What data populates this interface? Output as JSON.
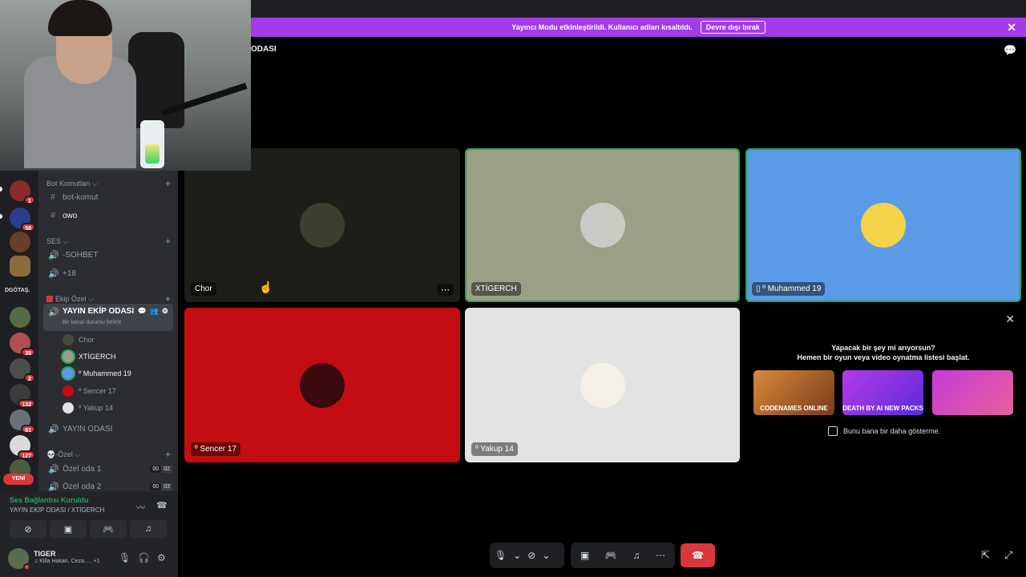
{
  "banner": {
    "text": "Yayıncı Modu etkinleştirildi. Kullanıcı adları kısaltıldı.",
    "button": "Devre dışı bırak",
    "close": "✕"
  },
  "header": {
    "title": "ODASI",
    "chat_icon": "chat-bubble-icon"
  },
  "servers": {
    "label": "DGÖTAŞ.",
    "badges": [
      "1",
      "58",
      "35",
      "2",
      "132",
      "61",
      "127"
    ],
    "new_label": "YENİ"
  },
  "channels": {
    "categories": [
      {
        "label": "Bot Komutları",
        "chev": "⌵",
        "plus": "+"
      },
      {
        "label": "SES",
        "chev": "⌵",
        "plus": "+"
      },
      {
        "label": "Ekip Özel",
        "chev": "⌵",
        "plus": "+"
      },
      {
        "label": "-Özel",
        "chev": "⌵",
        "plus": "+"
      }
    ],
    "text_channels": [
      "bot-komut",
      "owo"
    ],
    "voice_channels": [
      "-SOHBET",
      "+18"
    ],
    "active": {
      "name": "YAYIN EKİP ODASI",
      "status": "Bir kanal durumu belirle"
    },
    "members": [
      "Chor",
      "XTİGERCH",
      "º Muhammed 19",
      "º Sencer 17",
      "º Yakup 14"
    ],
    "other_voice": "YAYIN ODASI",
    "private": [
      {
        "name": "Özel oda 1",
        "limit_a": "00",
        "limit_b": "02"
      },
      {
        "name": "Özel oda 2",
        "limit_a": "00",
        "limit_b": "03"
      }
    ]
  },
  "voice_panel": {
    "status": "Ses Bağlantısı Kuruldu",
    "location": "YAYIN EKİP ODASI / XTİGERCH"
  },
  "user": {
    "name": "TIGER",
    "activity": "Killa Hakan, Ceza, ...",
    "extra": "+1"
  },
  "tiles": [
    {
      "label": "Chor",
      "bg": "#1d1d1a"
    },
    {
      "label": "XTİGERCH",
      "bg": "#9a9f86"
    },
    {
      "label": "º Muhammed 19",
      "bg": "#5b9ae6"
    },
    {
      "label": "º Sencer 17",
      "bg": "#c40d12"
    },
    {
      "label": "º Yakup 14",
      "bg": "#e3e3e3"
    }
  ],
  "suggestion": {
    "line1": "Yapacak bir şey mi arıyorsun?",
    "line2": "Hemen bir oyun veya video oynatma listesi başlat.",
    "cards": [
      "CODENAMES ONLINE",
      "DEATH BY AI NEW PACKS",
      ""
    ],
    "dont_show": "Bunu bana bir daha gösterme."
  },
  "accent": {
    "brand": "#5865f2",
    "banner": "#a33be8",
    "danger": "#da373c",
    "online": "#23a55a"
  }
}
